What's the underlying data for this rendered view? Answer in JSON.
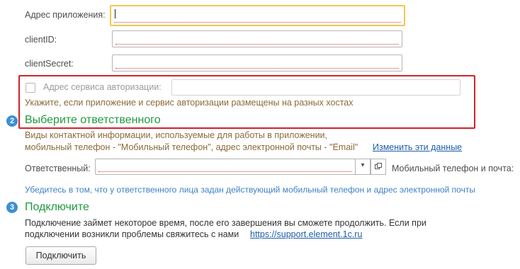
{
  "app_address": {
    "label": "Адрес приложения:",
    "value": ""
  },
  "client_id": {
    "label": "clientID:",
    "value": ""
  },
  "client_secret": {
    "label": "clientSecret:",
    "value": ""
  },
  "auth_service": {
    "checkbox_label": "Адрес сервиса авторизации:",
    "checked": false,
    "value": "",
    "hint": "Укажите, если приложение и сервис авторизации размещены на разных хостах"
  },
  "step2": {
    "number": "2",
    "title": "Выберите ответственного",
    "desc_line1": "Виды контактной информации, используемые для работы в приложении,",
    "desc_line2": "мобильный телефон - \"Мобильный телефон\", адрес электронной почты - \"Email\"",
    "change_link": "Изменить эти данные",
    "responsible_label": "Ответственный:",
    "responsible_value": "",
    "mobile_label": "Мобильный телефон и почта:",
    "note": "Убедитесь в том, что у ответственного лица задан действующий мобильный телефон и адрес электронной почты"
  },
  "step3": {
    "number": "3",
    "title": "Подключите",
    "desc_line1": "Подключение займет некоторое время, после его завершения вы сможете продолжить. Если при",
    "desc_line2_prefix": "подключении возникли проблемы свяжитесь с нами",
    "support_link": "https://support.element.1c.ru",
    "connect_button": "Подключить"
  },
  "colors": {
    "accent_green": "#1f9a3e",
    "link_blue": "#1f5fa8",
    "highlight_red": "#d2232a",
    "focus_yellow": "#f0c94f"
  }
}
